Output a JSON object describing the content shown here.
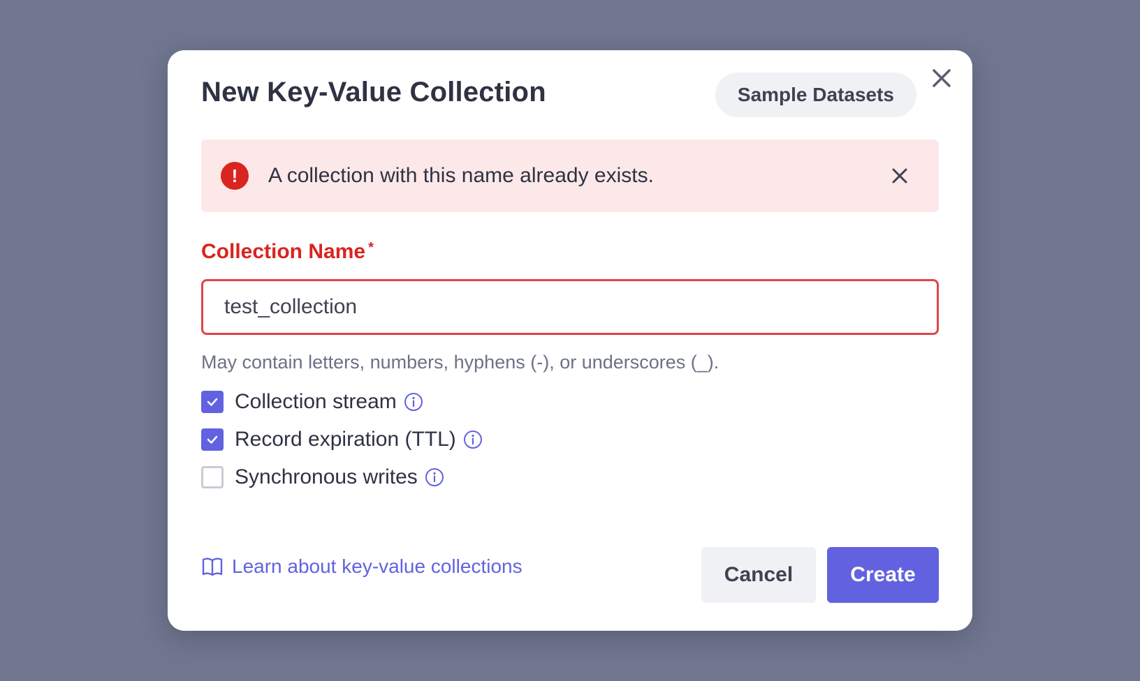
{
  "modal": {
    "title": "New Key-Value Collection",
    "sample_datasets_label": "Sample Datasets",
    "close_icon": "close-icon"
  },
  "alert": {
    "icon": "exclamation-icon",
    "message": "A collection with this name already exists.",
    "close_icon": "close-icon",
    "color": "#d9241f",
    "background": "#fce8e8"
  },
  "form": {
    "name_label": "Collection Name",
    "required_marker": "*",
    "name_value": "test_collection",
    "helper_text": "May contain letters, numbers, hyphens (-), or underscores (_).",
    "options": [
      {
        "label": "Collection stream",
        "checked": true,
        "icon": "info-icon"
      },
      {
        "label": "Record expiration (TTL)",
        "checked": true,
        "icon": "info-icon"
      },
      {
        "label": "Synchronous writes",
        "checked": false,
        "icon": "info-icon"
      }
    ]
  },
  "footer": {
    "learn_link": "Learn about key-value collections",
    "learn_icon": "book-icon",
    "cancel_label": "Cancel",
    "create_label": "Create"
  },
  "colors": {
    "accent": "#6262e0",
    "error": "#d9241f",
    "backdrop": "#717790"
  }
}
